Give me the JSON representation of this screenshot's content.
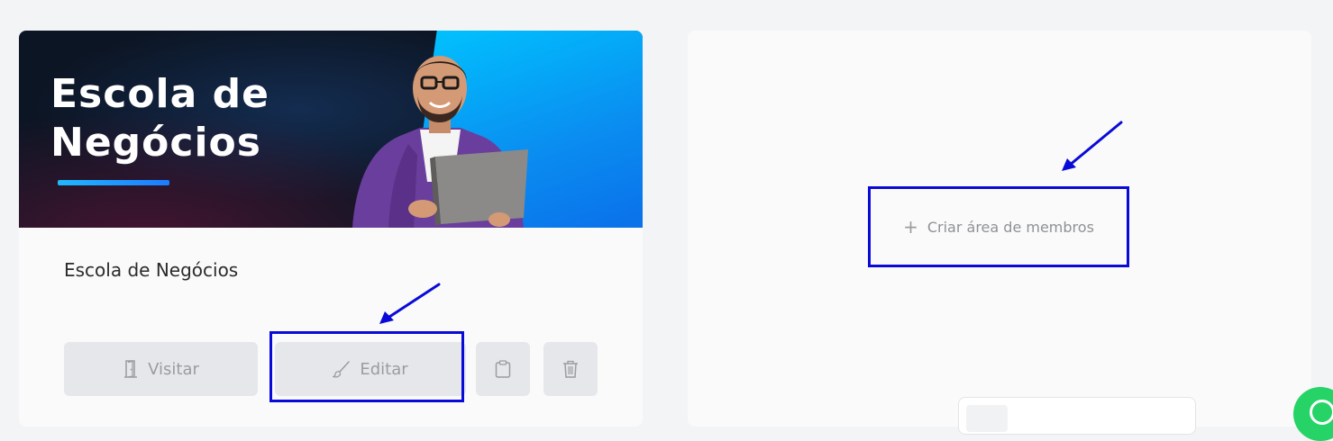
{
  "member_area_card": {
    "banner": {
      "heading_line1": "Escola de",
      "heading_line2": "Negócios"
    },
    "title": "Escola de Negócios",
    "actions": {
      "visit_label": "Visitar",
      "edit_label": "Editar"
    }
  },
  "create_card": {
    "create_label": "Criar área de membros",
    "create_icon": "+"
  },
  "colors": {
    "annotation": "#0a0ad8",
    "banner_accent": "#0a8cf0",
    "whatsapp": "#25d366"
  }
}
